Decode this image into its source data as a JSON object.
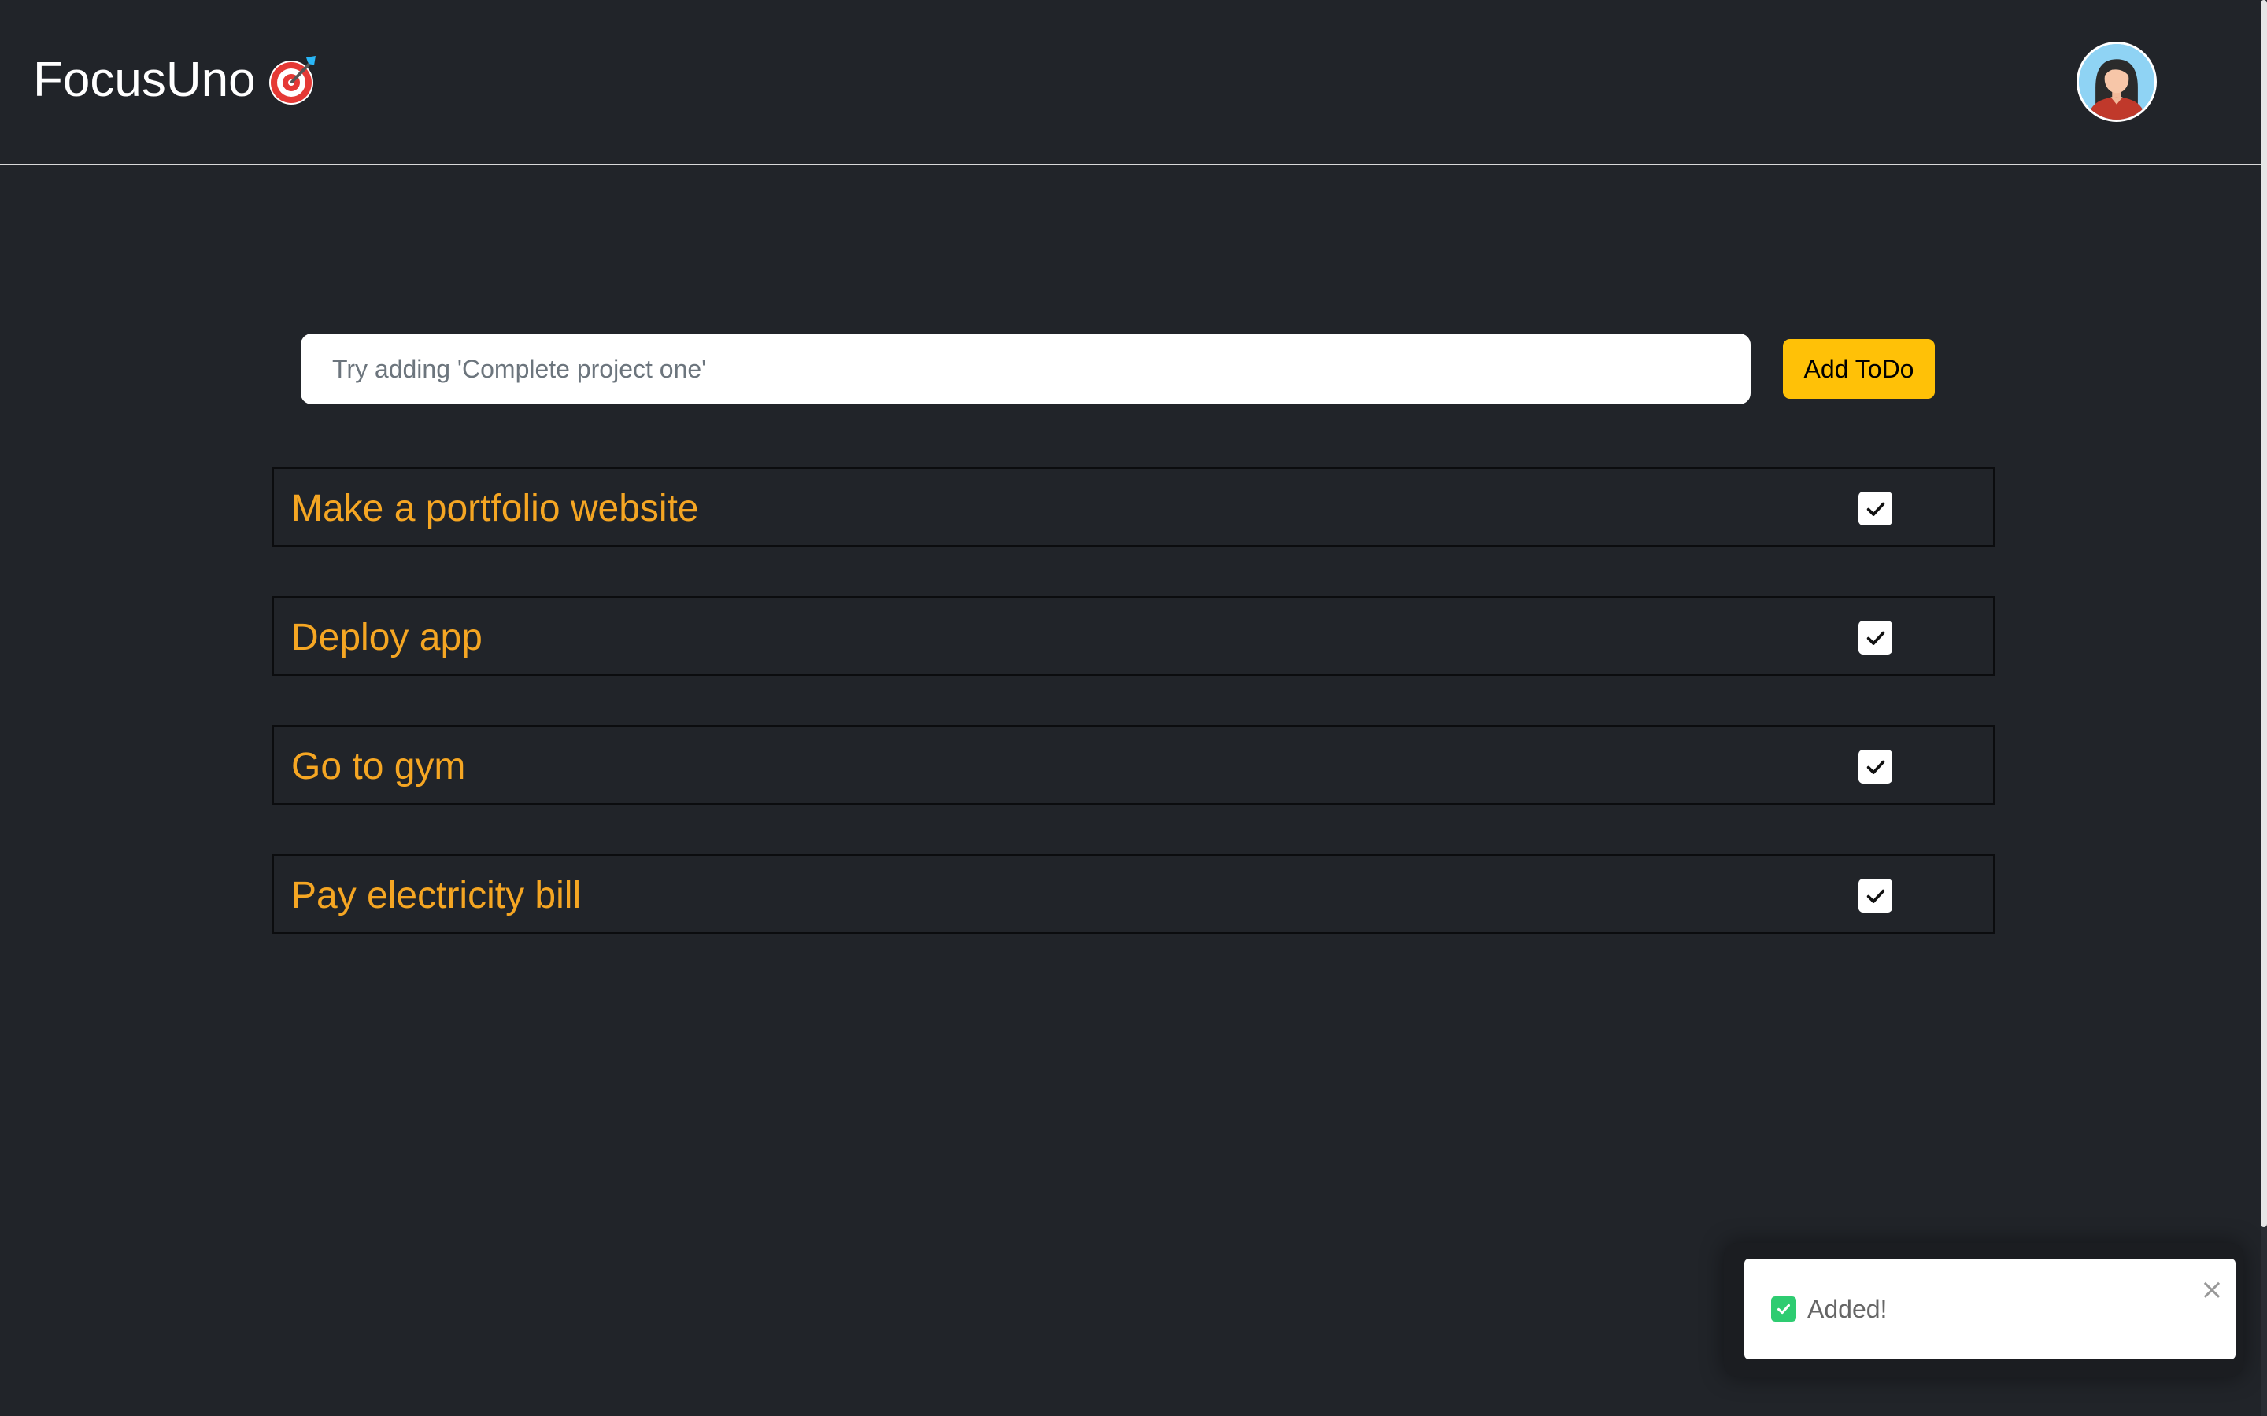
{
  "header": {
    "brand": "FocusUno",
    "brand_icon": "target-dart-icon",
    "avatar_icon": "user-avatar"
  },
  "input": {
    "placeholder": "Try adding 'Complete project one'",
    "value": "",
    "add_label": "Add ToDo"
  },
  "todos": [
    {
      "text": "Make a portfolio website",
      "checked": true
    },
    {
      "text": "Deploy app",
      "checked": true
    },
    {
      "text": "Go to gym",
      "checked": true
    },
    {
      "text": "Pay electricity bill",
      "checked": true
    }
  ],
  "toast": {
    "message": "Added!",
    "icon": "check-square-icon",
    "close": "×"
  },
  "colors": {
    "background": "#212429",
    "accent": "#ffc107",
    "todo_text": "#f5a623",
    "success": "#2ecc71"
  }
}
